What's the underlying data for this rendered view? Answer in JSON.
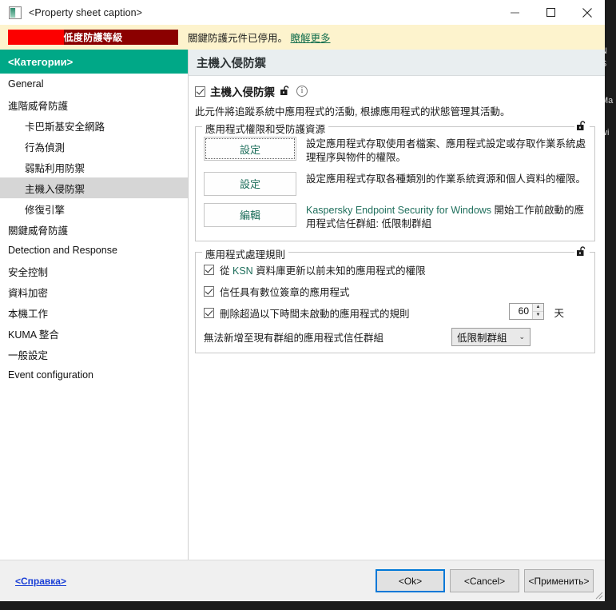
{
  "window": {
    "title": "<Property sheet caption>",
    "icon": "app-icon",
    "controls": {
      "minimize": "minimize-icon",
      "maximize": "maximize-icon",
      "close": "close-icon"
    }
  },
  "banner": {
    "level_label": "低度防護等級",
    "level_fill_percent": 33,
    "message": "關鍵防護元件已停用。",
    "link": "瞭解更多",
    "colors": {
      "background": "#fdf3cd",
      "bar_bg": "#8b0000",
      "bar_fill": "#fc0000",
      "link": "#16704f"
    }
  },
  "sidebar": {
    "header": "<Категории>",
    "accent": "#00a887",
    "items": [
      {
        "label": "General",
        "indent": false,
        "selected": false
      },
      {
        "label": "進階威脅防護",
        "indent": false,
        "selected": false
      },
      {
        "label": "卡巴斯基安全網路",
        "indent": true,
        "selected": false
      },
      {
        "label": "行為偵測",
        "indent": true,
        "selected": false
      },
      {
        "label": "弱點利用防禦",
        "indent": true,
        "selected": false
      },
      {
        "label": "主機入侵防禦",
        "indent": true,
        "selected": true
      },
      {
        "label": "修復引擎",
        "indent": true,
        "selected": false
      },
      {
        "label": "關鍵威脅防護",
        "indent": false,
        "selected": false
      },
      {
        "label": "Detection and Response",
        "indent": false,
        "selected": false
      },
      {
        "label": "安全控制",
        "indent": false,
        "selected": false
      },
      {
        "label": "資料加密",
        "indent": false,
        "selected": false
      },
      {
        "label": "本機工作",
        "indent": false,
        "selected": false
      },
      {
        "label": "KUMA 整合",
        "indent": false,
        "selected": false
      },
      {
        "label": "一般設定",
        "indent": false,
        "selected": false
      },
      {
        "label": "Event configuration",
        "indent": false,
        "selected": false
      }
    ]
  },
  "content": {
    "header": "主機入侵防禦",
    "feature": {
      "checkbox_checked": true,
      "title": "主機入侵防禦",
      "lock_icon": "unlocked-padlock-icon",
      "info_icon": "info-icon",
      "description": "此元件將追蹤系統中應用程式的活動, 根據應用程式的狀態管理其活動。"
    },
    "group_resources": {
      "title": "應用程式權限和受防護資源",
      "lock_icon": "unlocked-padlock-icon",
      "rows": [
        {
          "button": "設定",
          "focused": true,
          "description": "設定應用程式存取使用者檔案、應用程式設定或存取作業系統處理程序與物件的權限。",
          "description_prefix": ""
        },
        {
          "button": "設定",
          "focused": false,
          "description": "設定應用程式存取各種類別的作業系統資源和個人資料的權限。",
          "description_prefix": ""
        },
        {
          "button": "編輯",
          "focused": false,
          "description": "開始工作前啟動的應用程式信任群組: 低限制群組",
          "description_prefix": "Kaspersky Endpoint Security for Windows "
        }
      ]
    },
    "group_rules": {
      "title": "應用程式處理規則",
      "lock_icon": "unlocked-padlock-icon",
      "checkboxes": [
        {
          "checked": true,
          "label_pre": "從 ",
          "label_em": "KSN",
          "label_post": " 資料庫更新以前未知的應用程式的權限"
        },
        {
          "checked": true,
          "label_pre": "",
          "label_em": "",
          "label_post": "信任具有數位簽章的應用程式"
        },
        {
          "checked": true,
          "label_pre": "",
          "label_em": "",
          "label_post": "刪除超過以下時間未啟動的應用程式的規則"
        }
      ],
      "spinner": {
        "value": "60",
        "unit": "天"
      },
      "dropdown": {
        "label": "無法新增至現有群組的應用程式信任群組",
        "value": "低限制群組"
      }
    }
  },
  "footer": {
    "help_link": "<Справка>",
    "buttons": [
      {
        "label": "<Ok>",
        "primary": true
      },
      {
        "label": "<Cancel>",
        "primary": false
      },
      {
        "label": "<Применить>",
        "primary": false
      }
    ]
  },
  "backdrop": {
    "fragments": [
      "N",
      "S",
      "",
      "Ma",
      "",
      "wi"
    ]
  }
}
